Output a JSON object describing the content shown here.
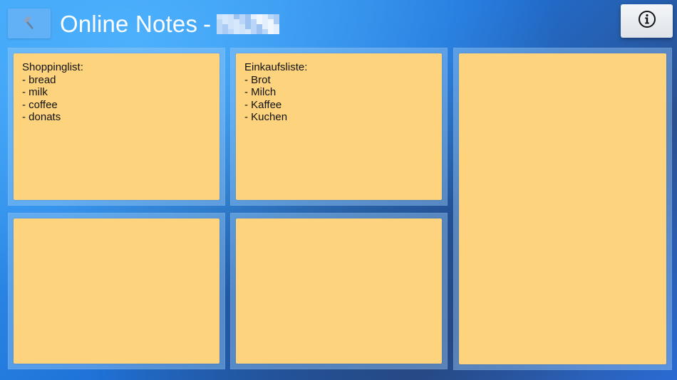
{
  "header": {
    "title": "Online Notes",
    "separator": "-",
    "tool_icon": "hammer-icon",
    "info_icon": "info-icon"
  },
  "notes": [
    {
      "lines": [
        "Shoppinglist:",
        "- bread",
        "- milk",
        "- coffee",
        "- donats"
      ]
    },
    {
      "lines": [
        "Einkaufsliste:",
        "- Brot",
        "- Milch",
        "- Kaffee",
        "- Kuchen"
      ]
    },
    {
      "lines": []
    },
    {
      "lines": []
    },
    {
      "lines": []
    }
  ],
  "colors": {
    "note_background": "#fdd47d",
    "title_text": "#ffffff",
    "accent": "#2a86ec"
  }
}
